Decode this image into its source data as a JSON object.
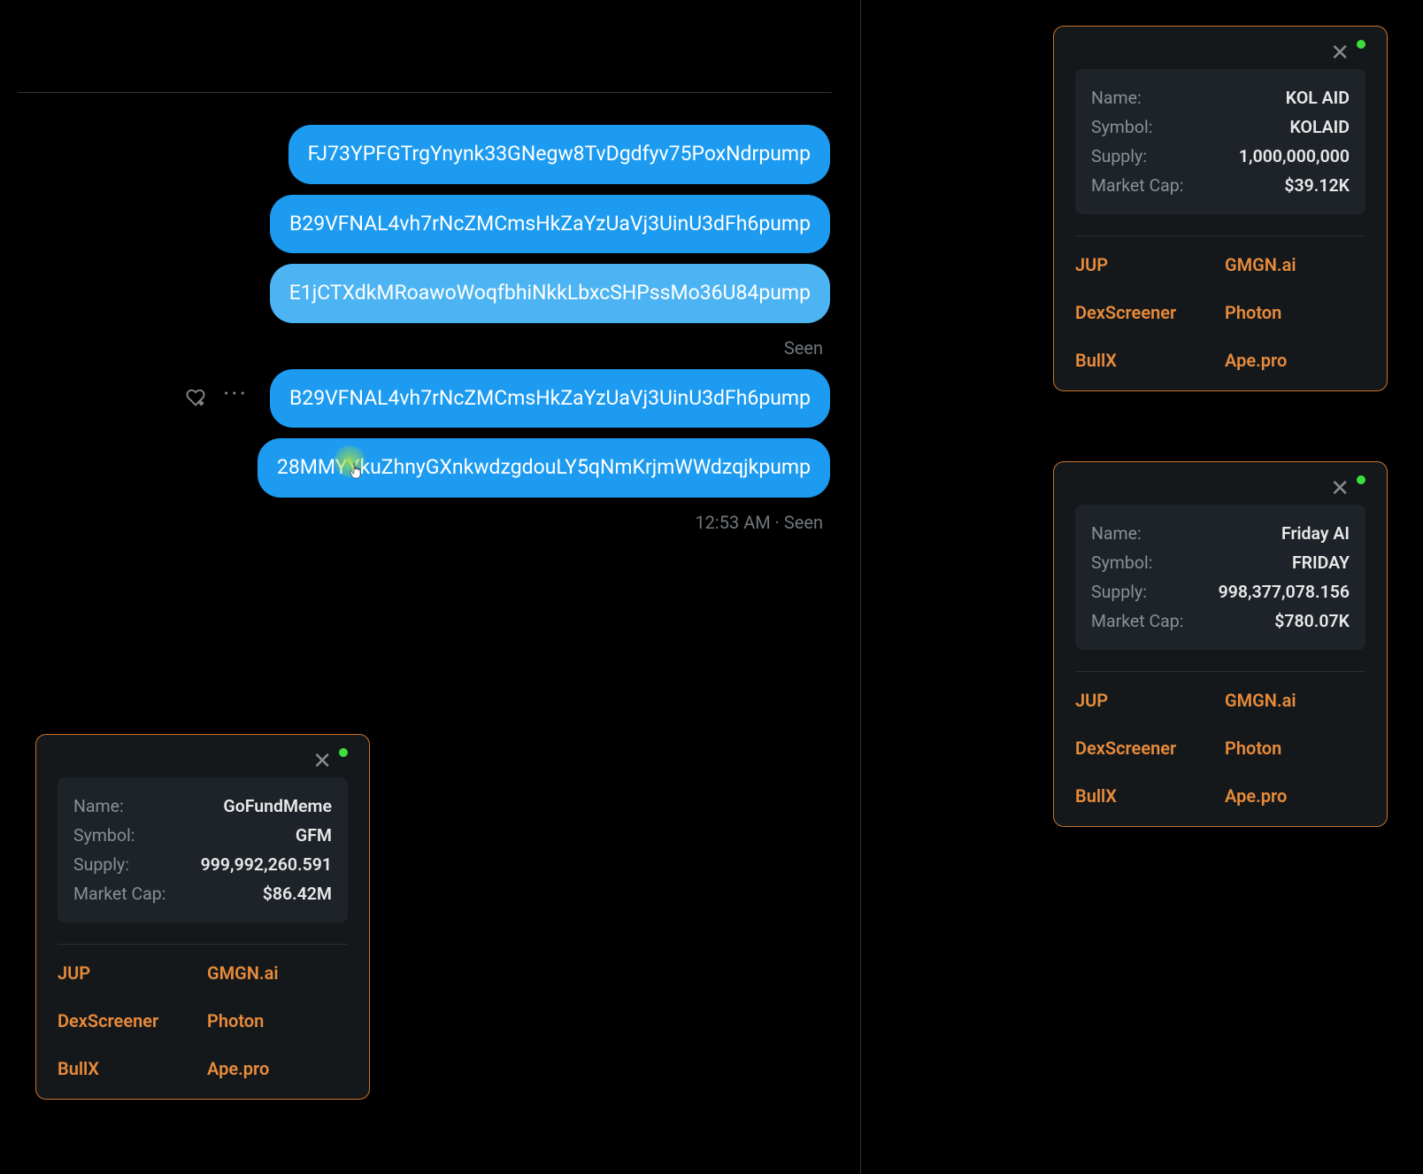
{
  "chat": {
    "messages": [
      {
        "text": "FJ73YPFGTrgYnynk33GNegw8TvDgdfyv75PoxNdrpump",
        "highlighted": false
      },
      {
        "text": "B29VFNAL4vh7rNcZMCmsHkZaYzUaVj3UinU3dFh6pump",
        "highlighted": false
      },
      {
        "text": "E1jCTXdkMRoawoWoqfbhiNkkLbxcSHPssMo36U84pump",
        "highlighted": true
      }
    ],
    "seen_1": "Seen",
    "messages_after": [
      {
        "text": "B29VFNAL4vh7rNcZMCmsHkZaYzUaVj3UinU3dFh6pump",
        "highlighted": false,
        "has_actions": true
      },
      {
        "text": "28MMYYkuZhnyGXnkwdzgdouLY5qNmKrjmWWdzqjkpump",
        "highlighted": false
      }
    ],
    "timestamp_seen": "12:53 AM · Seen"
  },
  "labels": {
    "name": "Name:",
    "symbol": "Symbol:",
    "supply": "Supply:",
    "marketcap": "Market Cap:"
  },
  "links": {
    "jup": "JUP",
    "gmgn": "GMGN.ai",
    "dexscreener": "DexScreener",
    "photon": "Photon",
    "bullx": "BullX",
    "apepro": "Ape.pro"
  },
  "cards": [
    {
      "name": "GoFundMeme",
      "symbol": "GFM",
      "supply": "999,992,260.591",
      "marketcap": "$86.42M"
    },
    {
      "name": "KOL AID",
      "symbol": "KOLAID",
      "supply": "1,000,000,000",
      "marketcap": "$39.12K"
    },
    {
      "name": "Friday AI",
      "symbol": "FRIDAY",
      "supply": "998,377,078.156",
      "marketcap": "$780.07K"
    }
  ]
}
